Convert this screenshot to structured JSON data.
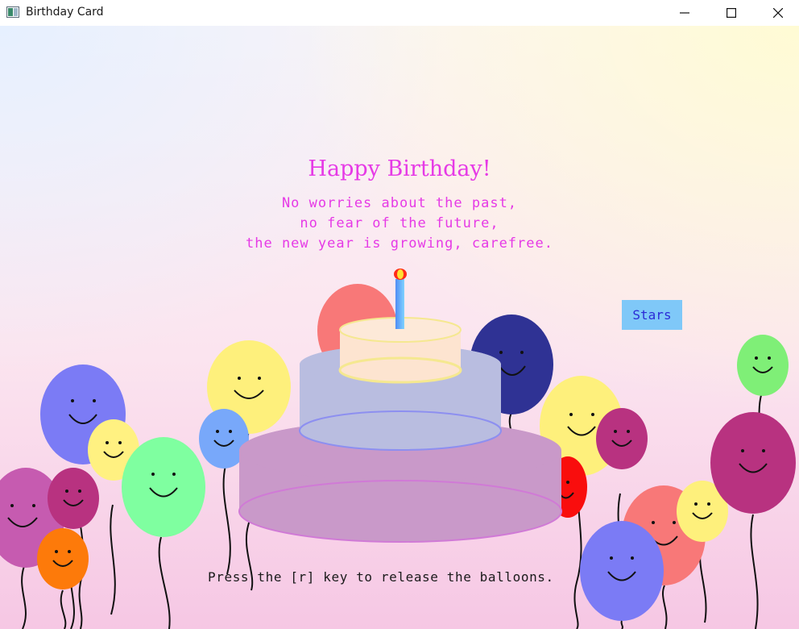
{
  "window": {
    "title": "Birthday Card",
    "controls": [
      "minimize",
      "maximize",
      "close"
    ]
  },
  "card": {
    "heading": "Happy Birthday!",
    "verse": [
      "No worries about the past,",
      "no fear of the future,",
      "the new year is growing, carefree."
    ],
    "stars_button": "Stars",
    "hint": "Press the [r] key to release the balloons."
  },
  "colors": {
    "text_accent": "#e63ae6",
    "button_bg": "#7fc8f8",
    "button_text": "#2b2bd6"
  },
  "cake": {
    "tiers": 3,
    "candles": 1,
    "colors": [
      "#c999c9",
      "#b9bde0",
      "#fde4d0"
    ]
  },
  "balloons": [
    {
      "color": "#c65bb0"
    },
    {
      "color": "#7b7bf5"
    },
    {
      "color": "#fff181"
    },
    {
      "color": "#b83280"
    },
    {
      "color": "#fd7a0a"
    },
    {
      "color": "#7fffa0"
    },
    {
      "color": "#fef07c"
    },
    {
      "color": "#78a8fa"
    },
    {
      "color": "#f87878"
    },
    {
      "color": "#2f3294"
    },
    {
      "color": "#fef07c"
    },
    {
      "color": "#b83280"
    },
    {
      "color": "#f90d0d"
    },
    {
      "color": "#f87878"
    },
    {
      "color": "#fef07c"
    },
    {
      "color": "#7b7bf5"
    },
    {
      "color": "#7fef77"
    },
    {
      "color": "#b83280"
    }
  ]
}
